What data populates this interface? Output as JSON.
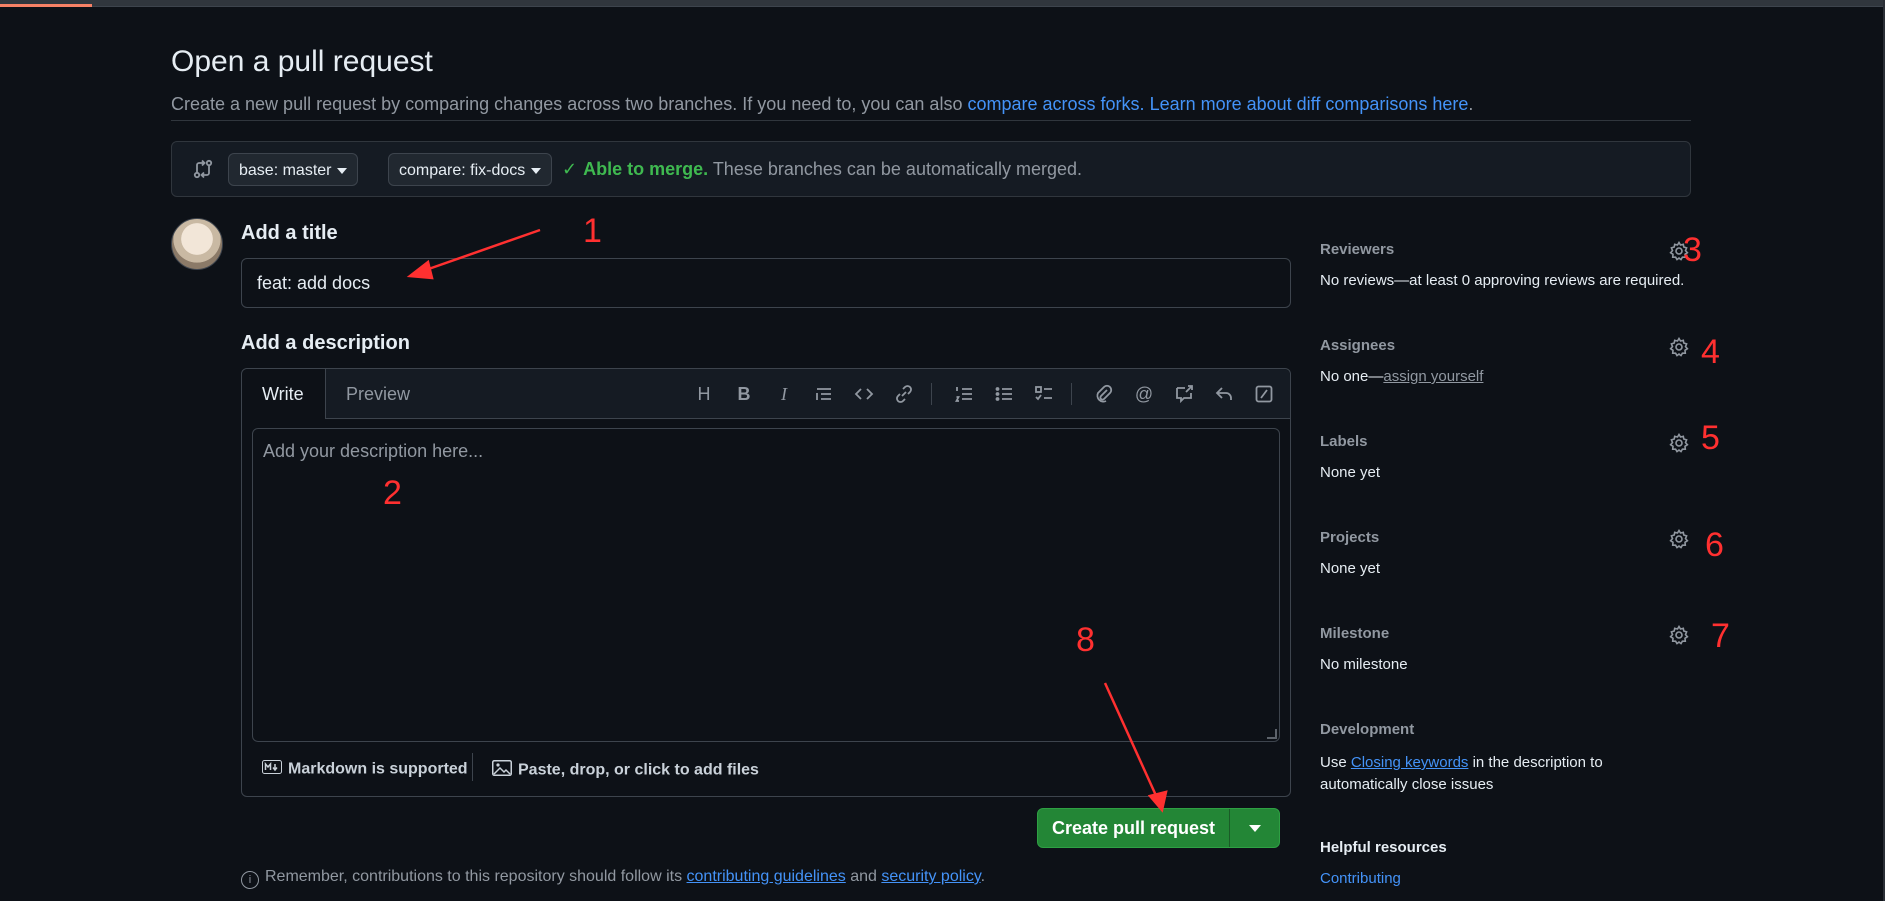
{
  "page": {
    "title": "Open a pull request",
    "subtitle_text": "Create a new pull request by comparing changes across two branches. If you need to, you can also",
    "link_forks": "compare across forks.",
    "link_learn": "Learn more about diff comparisons here",
    "subtitle_end": "."
  },
  "compare": {
    "base_label": "base: master",
    "compare_label": "compare: fix-docs",
    "merge_status": "Able to merge.",
    "merge_detail": "These branches can be automatically merged."
  },
  "form": {
    "title_label": "Add a title",
    "title_value": "feat: add docs",
    "description_label": "Add a description",
    "tab_write": "Write",
    "tab_preview": "Preview",
    "description_placeholder": "Add your description here...",
    "markdown_note": "Markdown is supported",
    "attach_note": "Paste, drop, or click to add files",
    "submit_label": "Create pull request",
    "remember_text": "Remember, contributions to this repository should follow its",
    "remember_link1": "contributing guidelines",
    "remember_and": "and",
    "remember_link2": "security policy",
    "remember_end": "."
  },
  "sidebar": {
    "reviewers": {
      "heading": "Reviewers",
      "value": "No reviews—at least 0 approving reviews are required."
    },
    "assignees": {
      "heading": "Assignees",
      "value": "No one—",
      "link": "assign yourself"
    },
    "labels": {
      "heading": "Labels",
      "value": "None yet"
    },
    "projects": {
      "heading": "Projects",
      "value": "None yet"
    },
    "milestone": {
      "heading": "Milestone",
      "value": "No milestone"
    },
    "development": {
      "heading": "Development",
      "value_pre": "Use",
      "value_link": "Closing keywords",
      "value_post": "in the description to automatically close issues"
    },
    "helpful": {
      "heading": "Helpful resources",
      "link1": "Contributing"
    }
  },
  "annotations": [
    "1",
    "2",
    "3",
    "4",
    "5",
    "6",
    "7",
    "8"
  ],
  "colors": {
    "background": "#0d1117",
    "accent_link": "#4493f8",
    "success": "#3fb950",
    "primary_button": "#238636",
    "annotation": "#ff3030"
  }
}
